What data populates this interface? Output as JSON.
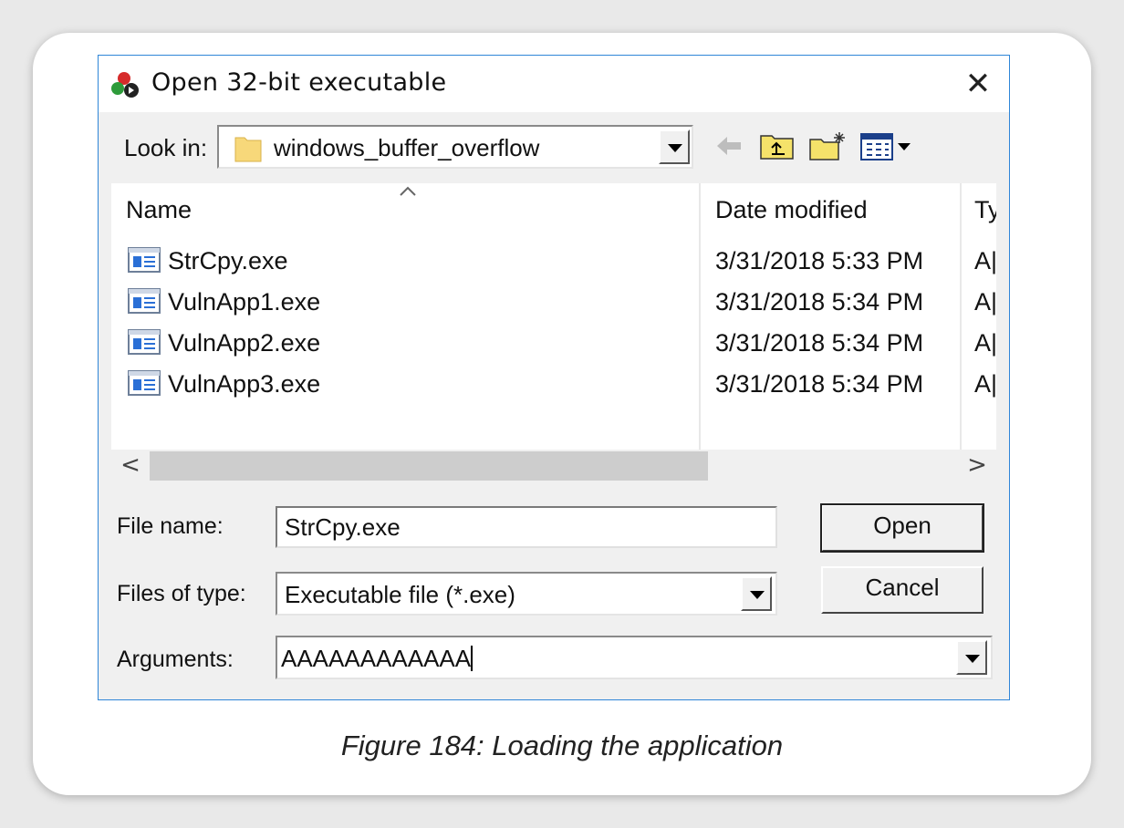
{
  "dialog": {
    "title": "Open 32-bit executable",
    "close_label": "✕"
  },
  "lookin": {
    "label": "Look in:",
    "value": "windows_buffer_overflow"
  },
  "columns": {
    "name": "Name",
    "date": "Date modified",
    "type": "Ty"
  },
  "files": [
    {
      "name": "StrCpy.exe",
      "date": "3/31/2018 5:33 PM",
      "type": "A|"
    },
    {
      "name": "VulnApp1.exe",
      "date": "3/31/2018 5:34 PM",
      "type": "A|"
    },
    {
      "name": "VulnApp2.exe",
      "date": "3/31/2018 5:34 PM",
      "type": "A|"
    },
    {
      "name": "VulnApp3.exe",
      "date": "3/31/2018 5:34 PM",
      "type": "A|"
    }
  ],
  "scroll": {
    "left": "<",
    "right": ">"
  },
  "form": {
    "filename_label": "File name:",
    "filename_value": "StrCpy.exe",
    "filetype_label": "Files of type:",
    "filetype_value": "Executable file (*.exe)",
    "arguments_label": "Arguments:",
    "arguments_value": "AAAAAAAAAAAA"
  },
  "buttons": {
    "open": "Open",
    "cancel": "Cancel"
  },
  "icons": {
    "app": "process-app-icon",
    "folder": "folder-icon",
    "back": "back-arrow-icon",
    "up": "up-folder-icon",
    "new_folder": "new-folder-icon",
    "view_menu": "view-menu-icon",
    "file": "executable-file-icon"
  },
  "caption": "Figure 184: Loading the application"
}
